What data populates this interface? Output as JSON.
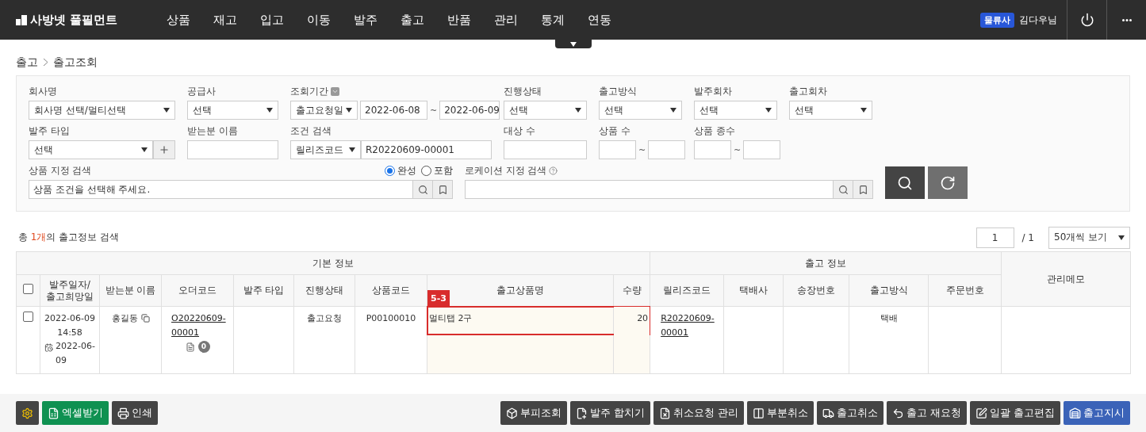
{
  "header": {
    "logo": "사방넷 풀필먼트",
    "nav": [
      "상품",
      "재고",
      "입고",
      "이동",
      "발주",
      "출고",
      "반품",
      "관리",
      "통계",
      "연동"
    ],
    "user_badge": "물류사",
    "user_name": "김다우님"
  },
  "breadcrumb": [
    "출고",
    "출고조회"
  ],
  "filters": {
    "rows": [
      [
        {
          "kind": "select",
          "label": "회사명",
          "value": "회사명 선택/멀티선택"
        },
        {
          "kind": "select",
          "label": "공급사",
          "value": "선택"
        },
        {
          "kind": "date_range",
          "label": "조회기간",
          "type": "출고요청일",
          "from": "2022-06-08",
          "separator": "~",
          "to": "2022-06-09"
        },
        {
          "kind": "select",
          "label": "진행상태",
          "value": "선택"
        },
        {
          "kind": "select",
          "label": "출고방식",
          "value": "선택"
        },
        {
          "kind": "select",
          "label": "발주회차",
          "value": "선택"
        },
        {
          "kind": "select",
          "label": "출고회차",
          "value": "선택"
        }
      ],
      [
        {
          "kind": "select_add",
          "label": "발주 타입",
          "value": "선택"
        },
        {
          "kind": "text",
          "label": "받는분 이름"
        },
        {
          "kind": "condition",
          "label": "조건 검색",
          "type": "릴리즈코드",
          "value": "R20220609-00001"
        },
        {
          "kind": "text",
          "label": "대상 수"
        },
        {
          "kind": "range",
          "label": "상품 수",
          "separator": "~"
        },
        {
          "kind": "range",
          "label": "상품 종수",
          "separator": "~"
        }
      ]
    ],
    "product_search": {
      "label": "상품 지정 검색",
      "placeholder": "상품 조건을 선택해 주세요.",
      "options": [
        {
          "label": "완성",
          "selected": true
        },
        {
          "label": "포함",
          "selected": false
        }
      ]
    },
    "location_search": {
      "label": "로케이션 지정 검색"
    }
  },
  "summary": {
    "prefix": "총 ",
    "count": "1개",
    "suffix": "의 출고정보 검색"
  },
  "pagination": {
    "page": "1",
    "total": "/ 1",
    "per_page": "50개씩 보기"
  },
  "table": {
    "groups": [
      "기본 정보",
      "출고 정보"
    ],
    "memo_column": "관리메모",
    "select_all_checked": false,
    "columns": [
      "발주일자/\n출고희망일",
      "받는분 이름",
      "오더코드",
      "발주 타입",
      "진행상태",
      "상품코드",
      "출고상품명",
      "수량",
      "릴리즈코드",
      "택배사",
      "송장번호",
      "출고방식",
      "주문번호"
    ],
    "rows": [
      {
        "checked": false,
        "order_date": "2022-06-09",
        "order_time": "14:58",
        "hope_date": "2022-06-09",
        "receiver": "홍길동",
        "order_code": "O20220609-00001",
        "memo_count": "0",
        "status": "출고요청",
        "product_code": "P00100010",
        "product_name": "멀티탭 2구",
        "quantity": "20",
        "release_code": "R20220609-00001",
        "method": "택배"
      }
    ],
    "annotation": "5-3"
  },
  "footer": {
    "left": [
      {
        "kind": "settings"
      },
      {
        "kind": "excel",
        "label": "엑셀받기"
      },
      {
        "kind": "default",
        "label": "인쇄"
      }
    ],
    "right": [
      {
        "kind": "default",
        "label": "부피조회"
      },
      {
        "kind": "default",
        "label": "발주 합치기"
      },
      {
        "kind": "default",
        "label": "취소요청 관리"
      },
      {
        "kind": "default",
        "label": "부분취소"
      },
      {
        "kind": "default",
        "label": "출고취소"
      },
      {
        "kind": "default",
        "label": "출고 재요청"
      },
      {
        "kind": "default",
        "label": "일괄 출고편집"
      },
      {
        "kind": "primary",
        "label": "출고지시"
      }
    ]
  }
}
